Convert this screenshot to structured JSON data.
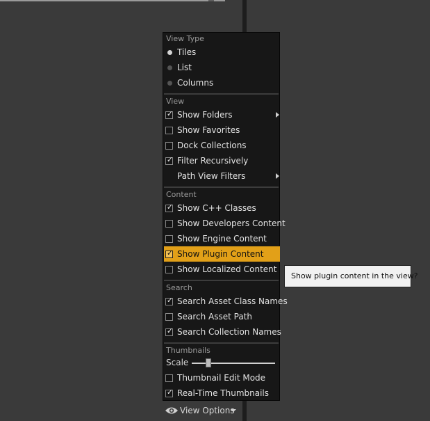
{
  "view_type": {
    "header": "View Type",
    "items": [
      {
        "label": "Tiles",
        "selected": true
      },
      {
        "label": "List",
        "selected": false
      },
      {
        "label": "Columns",
        "selected": false
      }
    ]
  },
  "view": {
    "header": "View",
    "items": [
      {
        "label": "Show Folders",
        "checked": true,
        "submenu": true
      },
      {
        "label": "Show Favorites",
        "checked": false
      },
      {
        "label": "Dock Collections",
        "checked": false
      },
      {
        "label": "Filter Recursively",
        "checked": true
      },
      {
        "label": "Path View Filters",
        "submenu": true
      }
    ]
  },
  "content": {
    "header": "Content",
    "items": [
      {
        "label": "Show C++ Classes",
        "checked": true
      },
      {
        "label": "Show Developers Content",
        "checked": false
      },
      {
        "label": "Show Engine Content",
        "checked": false
      },
      {
        "label": "Show Plugin Content",
        "checked": true,
        "highlighted": true
      },
      {
        "label": "Show Localized Content",
        "checked": false
      }
    ]
  },
  "search": {
    "header": "Search",
    "items": [
      {
        "label": "Search Asset Class Names",
        "checked": true
      },
      {
        "label": "Search Asset Path",
        "checked": false
      },
      {
        "label": "Search Collection Names",
        "checked": true
      }
    ]
  },
  "thumbnails": {
    "header": "Thumbnails",
    "scale_label": "Scale",
    "scale_value": 0.2,
    "items": [
      {
        "label": "Thumbnail Edit Mode",
        "checked": false
      },
      {
        "label": "Real-Time Thumbnails",
        "checked": true
      }
    ]
  },
  "tooltip": "Show plugin content in the view?",
  "view_options_label": "View Options",
  "icons": {
    "check": "checkmark-icon",
    "radio": "radio-dot-icon",
    "submenu": "submenu-arrow-icon",
    "eye": "eye-icon",
    "dropdown": "dropdown-arrow-icon"
  },
  "colors": {
    "highlight": "#e2a018",
    "menu_bg": "#171717",
    "panel_bg": "#3a3a3a"
  }
}
